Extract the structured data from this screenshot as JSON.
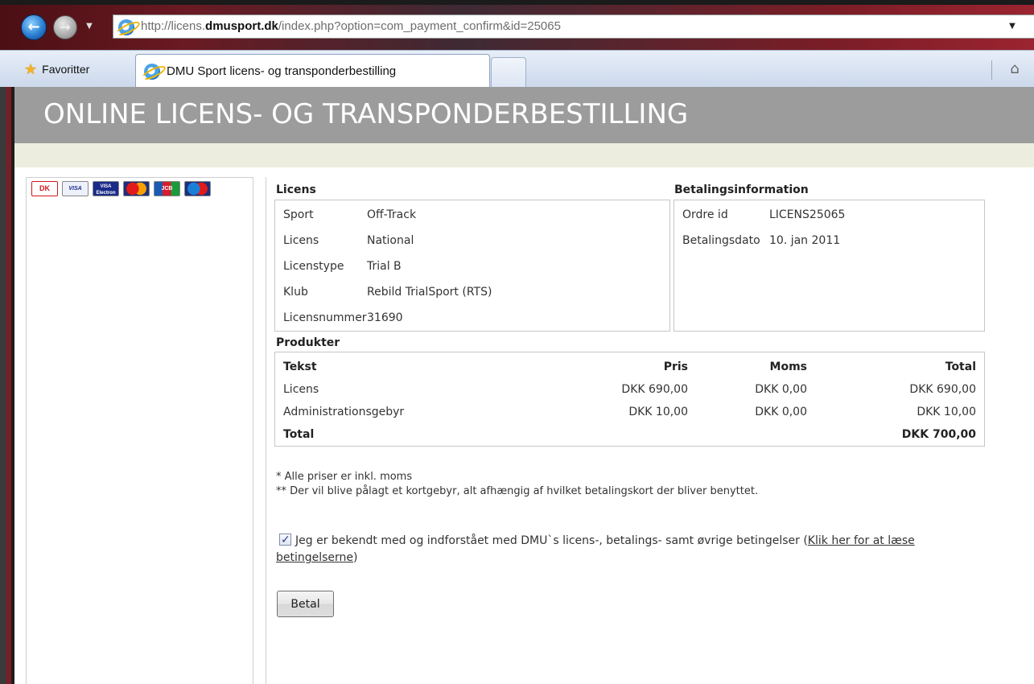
{
  "browser": {
    "url_prefix": "http://licens.",
    "url_domain": "dmusport.dk",
    "url_suffix": "/index.php?option=com_payment_confirm&id=25065",
    "favorites_label": "Favoritter",
    "tab_title": "DMU Sport licens- og transponderbestilling"
  },
  "header": {
    "title": "ONLINE LICENS- OG TRANSPONDERBESTILLING"
  },
  "payment_cards": [
    {
      "name": "dankort-icon",
      "label": "DK"
    },
    {
      "name": "visa-icon",
      "label": "VISA"
    },
    {
      "name": "visa-electron-icon",
      "label": "VISA Electron"
    },
    {
      "name": "mastercard-icon",
      "label": "MasterCard"
    },
    {
      "name": "jcb-icon",
      "label": "JCB"
    },
    {
      "name": "maestro-icon",
      "label": "Maestro"
    }
  ],
  "licens": {
    "title": "Licens",
    "rows": [
      {
        "key": "Sport",
        "value": "Off-Track"
      },
      {
        "key": "Licens",
        "value": "National"
      },
      {
        "key": "Licenstype",
        "value": "Trial B"
      },
      {
        "key": "Klub",
        "value": "Rebild TrialSport (RTS)"
      },
      {
        "key": "Licensnummer",
        "value": "31690"
      }
    ]
  },
  "betaling": {
    "title": "Betalingsinformation",
    "rows": [
      {
        "key": "Ordre id",
        "value": "LICENS25065"
      },
      {
        "key": "Betalingsdato",
        "value": "10. jan 2011"
      }
    ]
  },
  "produkter": {
    "title": "Produkter",
    "columns": {
      "text": "Tekst",
      "pris": "Pris",
      "moms": "Moms",
      "total": "Total"
    },
    "rows": [
      {
        "text": "Licens",
        "pris": "DKK 690,00",
        "moms": "DKK 0,00",
        "total": "DKK 690,00"
      },
      {
        "text": "Administrationsgebyr",
        "pris": "DKK 10,00",
        "moms": "DKK 0,00",
        "total": "DKK 10,00"
      }
    ],
    "total_label": "Total",
    "total_value": "DKK 700,00"
  },
  "notes": [
    "* Alle priser er inkl. moms",
    "** Der vil blive pålagt et kortgebyr, alt afhængig af hvilket betalingskort der bliver benyttet."
  ],
  "agreement": {
    "checked": true,
    "text": "Jeg er bekendt med og indforstået med DMU`s licens-, betalings- samt øvrige betingelser (",
    "link": "Klik her for at læse betingelserne",
    "suffix": ")"
  },
  "pay_button": "Betal"
}
